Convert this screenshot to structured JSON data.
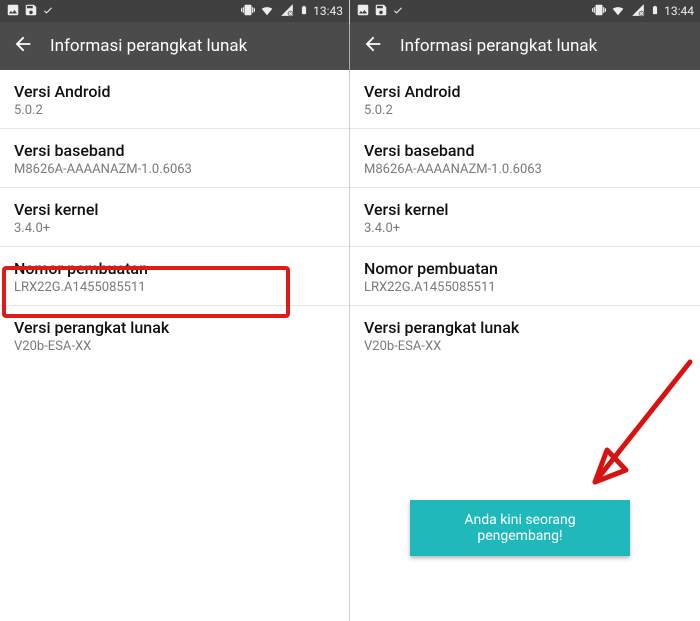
{
  "left": {
    "status": {
      "time": "13:43"
    },
    "appbar": {
      "title": "Informasi perangkat lunak"
    },
    "rows": [
      {
        "label": "Versi Android",
        "value": "5.0.2"
      },
      {
        "label": "Versi baseband",
        "value": "M8626A-AAAANAZM-1.0.6063"
      },
      {
        "label": "Versi kernel",
        "value": "3.4.0+"
      },
      {
        "label": "Nomor pembuatan",
        "value": "LRX22G.A1455085511"
      },
      {
        "label": "Versi perangkat lunak",
        "value": "V20b-ESA-XX"
      }
    ]
  },
  "right": {
    "status": {
      "time": "13:44"
    },
    "appbar": {
      "title": "Informasi perangkat lunak"
    },
    "rows": [
      {
        "label": "Versi Android",
        "value": "5.0.2"
      },
      {
        "label": "Versi baseband",
        "value": "M8626A-AAAANAZM-1.0.6063"
      },
      {
        "label": "Versi kernel",
        "value": "3.4.0+"
      },
      {
        "label": "Nomor pembuatan",
        "value": "LRX22G.A1455085511"
      },
      {
        "label": "Versi perangkat lunak",
        "value": "V20b-ESA-XX"
      }
    ],
    "toast": "Anda kini seorang pengembang!"
  }
}
